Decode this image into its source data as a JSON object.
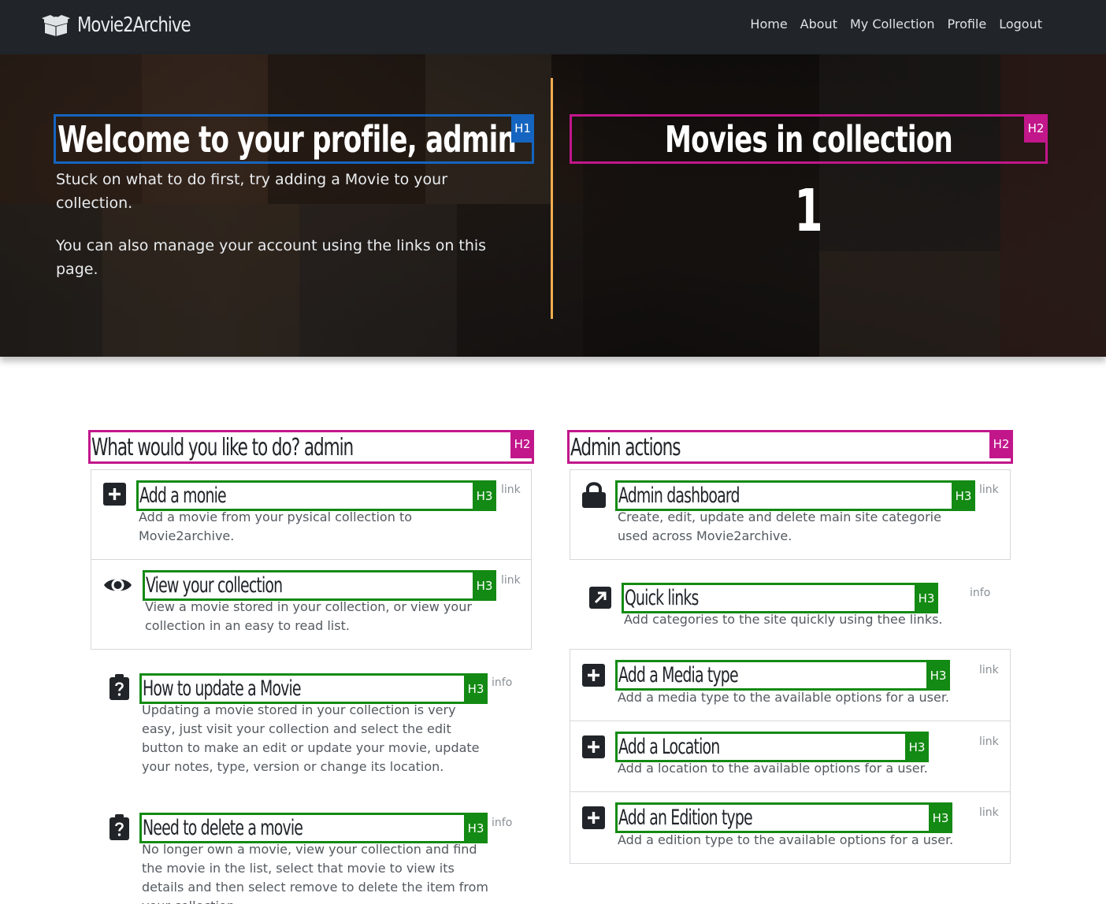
{
  "navbar": {
    "brand": "Movie2Archive",
    "brand_icon": "box-open-icon",
    "links": [
      "Home",
      "About",
      "My Collection",
      "Profile",
      "Logout"
    ]
  },
  "hero": {
    "title": "Welcome to your profile, admin",
    "title_tag": "H1",
    "paragraph1": "Stuck on what to do first, try adding a Movie to your collection.",
    "paragraph2": "You can also manage your account using the links on this page.",
    "count_title": "Movies in collection",
    "count_title_tag": "H2",
    "count": "1",
    "divider_color": "#f0ad4e"
  },
  "user_section": {
    "heading": "What would you like to do? admin",
    "heading_tag": "H2",
    "items": [
      {
        "icon": "plus-square-icon",
        "title": "Add a monie",
        "tag": "H3",
        "type": "link",
        "description": "Add a movie from your pysical collection to Movie2archive."
      },
      {
        "icon": "eye-icon",
        "title": "View your collection",
        "tag": "H3",
        "type": "link",
        "description": "View a movie stored in your collection, or view your collection in an easy to read list."
      },
      {
        "icon": "clipboard-question-icon",
        "title": "How to update a Movie",
        "tag": "H3",
        "type": "info",
        "description": "Updating a movie stored in your collection is very easy, just visit your collection and select the edit button to make an edit or update your movie, update your notes, type, version or change its location."
      },
      {
        "icon": "clipboard-question-icon",
        "title": "Need to delete a movie",
        "tag": "H3",
        "type": "info",
        "description": "No longer own a movie, view your collection and find the movie in the list, select that movie to view its details and then select remove to delete the item from your collection."
      }
    ]
  },
  "admin_section": {
    "heading": "Admin actions",
    "heading_tag": "H2",
    "items": [
      {
        "icon": "lock-icon",
        "title": "Admin dashboard",
        "tag": "H3",
        "type": "link",
        "description": "Create, edit, update and delete main site categorie used across Movie2archive."
      },
      {
        "icon": "external-link-square-icon",
        "title": "Quick links",
        "tag": "H3",
        "type": "info",
        "description": "Add categories to the site quickly using thee links."
      },
      {
        "icon": "plus-square-icon",
        "title": "Add a Media type",
        "tag": "H3",
        "type": "link",
        "description": "Add a media type to the available options for a user."
      },
      {
        "icon": "plus-square-icon",
        "title": "Add a Location",
        "tag": "H3",
        "type": "link",
        "description": "Add a location to the available options for a user."
      },
      {
        "icon": "plus-square-icon",
        "title": "Add an Edition type",
        "tag": "H3",
        "type": "link",
        "description": "Add a edition type to the available options for a user."
      }
    ]
  },
  "colors": {
    "navbar_bg": "#212529",
    "h1_outline": "#1565c0",
    "h2_outline": "#c2178b",
    "h3_outline": "#138a13"
  }
}
